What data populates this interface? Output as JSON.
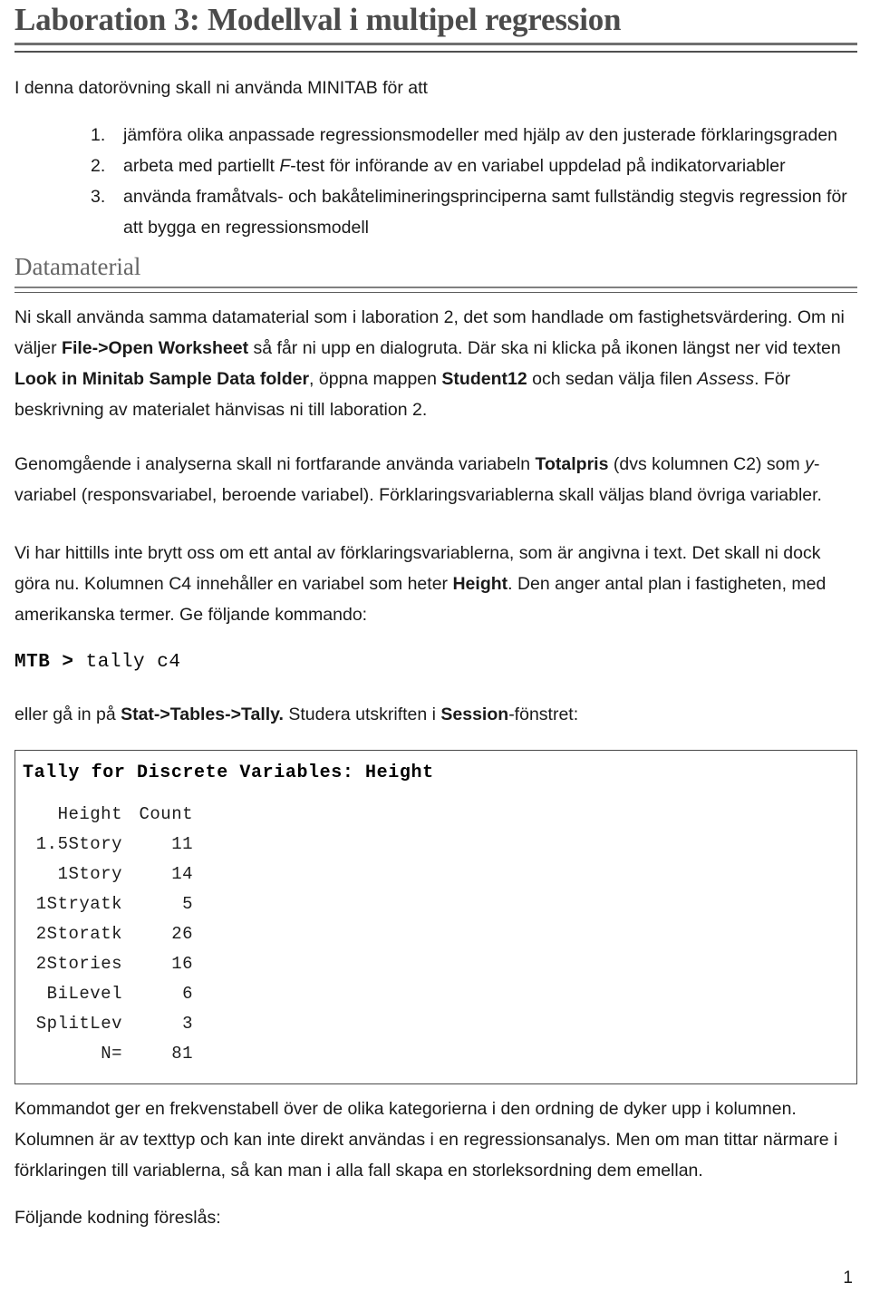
{
  "document": {
    "title": "Laboration 3: Modellval i multipel regression",
    "intro": "I denna datorövning skall ni använda MINITAB för att",
    "tasks": [
      {
        "num": "1.",
        "text": "jämföra olika anpassade regressionsmodeller med hjälp av den justerade förklaringsgraden"
      },
      {
        "num": "2.",
        "text_a": "arbeta med partiellt ",
        "text_em": "F",
        "text_b": "-test för införande av en variabel uppdelad på indikatorvariabler"
      },
      {
        "num": "3.",
        "text": "använda framåtvals- och bakåtelimineringsprinciperna samt fullständig stegvis regression för att bygga en regressionsmodell"
      }
    ],
    "section_heading": "Datamaterial",
    "paragraph_data_1": "Ni skall använda samma datamaterial som i laboration 2, det som handlade om fastighetsvärdering. Om ni väljer ",
    "paragraph_data_1_b1": "File->Open Worksheet",
    "paragraph_data_1_c": " så får ni upp en dialogruta. Där ska ni klicka på ikonen längst ner vid texten ",
    "paragraph_data_1_b2": "Look in Minitab Sample Data folder",
    "paragraph_data_1_d": ", öppna mappen ",
    "paragraph_data_1_b3": "Student12",
    "paragraph_data_1_e": " och sedan välja filen ",
    "paragraph_data_1_i1": "Assess",
    "paragraph_data_1_f": ". För beskrivning av materialet hänvisas ni till laboration 2.",
    "paragraph_2_a": "Genomgående i analyserna skall ni fortfarande använda variabeln ",
    "paragraph_2_b1": "Totalpris",
    "paragraph_2_c": " (dvs kolumnen C2) som ",
    "paragraph_2_i1": "y",
    "paragraph_2_d": "-variabel (responsvariabel, beroende variabel). Förklaringsvariablerna skall väljas bland övriga variabler.",
    "paragraph_3_a": "Vi har hittills inte brytt oss om ett antal av förklaringsvariablerna, som är angivna i text. Det skall ni dock göra nu. Kolumnen C4 innehåller en variabel som heter ",
    "paragraph_3_b1": "Height",
    "paragraph_3_c": ". Den anger antal plan i fastigheten, med amerikanska termer. Ge följande kommando:",
    "mtb_prompt": "MTB >",
    "mtb_command": " tally c4",
    "paragraph_4_a": "eller gå in på ",
    "paragraph_4_b1": "Stat->Tables->Tally.",
    "paragraph_4_c": " Studera utskriften i ",
    "paragraph_4_b2": "Session",
    "paragraph_4_d": "-fönstret:",
    "paragraph_5": "Kommandot ger en frekvenstabell över de olika kategorierna i den ordning de dyker upp i kolumnen. Kolumnen är av texttyp och kan inte direkt användas i en regressionsanalys. Men om man tittar närmare i förklaringen till variablerna, så kan man i alla fall skapa en storleksordning dem emellan.",
    "paragraph_6": "Följande kodning föreslås:",
    "page_number": "1"
  },
  "output_box": {
    "title": "Tally for Discrete Variables: Height",
    "columns": [
      "Height",
      "Count"
    ],
    "rows": [
      {
        "category": "1.5Story",
        "count": "11"
      },
      {
        "category": "1Story",
        "count": "14"
      },
      {
        "category": "1Stryatk",
        "count": "5"
      },
      {
        "category": "2Storatk",
        "count": "26"
      },
      {
        "category": "2Stories",
        "count": "16"
      },
      {
        "category": "BiLevel",
        "count": "6"
      },
      {
        "category": "SplitLev",
        "count": "3"
      }
    ],
    "total_label": "N=",
    "total_value": "81"
  },
  "colors": {
    "title_gray": "#4b4b4b",
    "heading_gray": "#666666",
    "rule_gray": "#6f6f6f",
    "body_black": "#1a1a1a",
    "box_border": "#4a4a4a"
  }
}
